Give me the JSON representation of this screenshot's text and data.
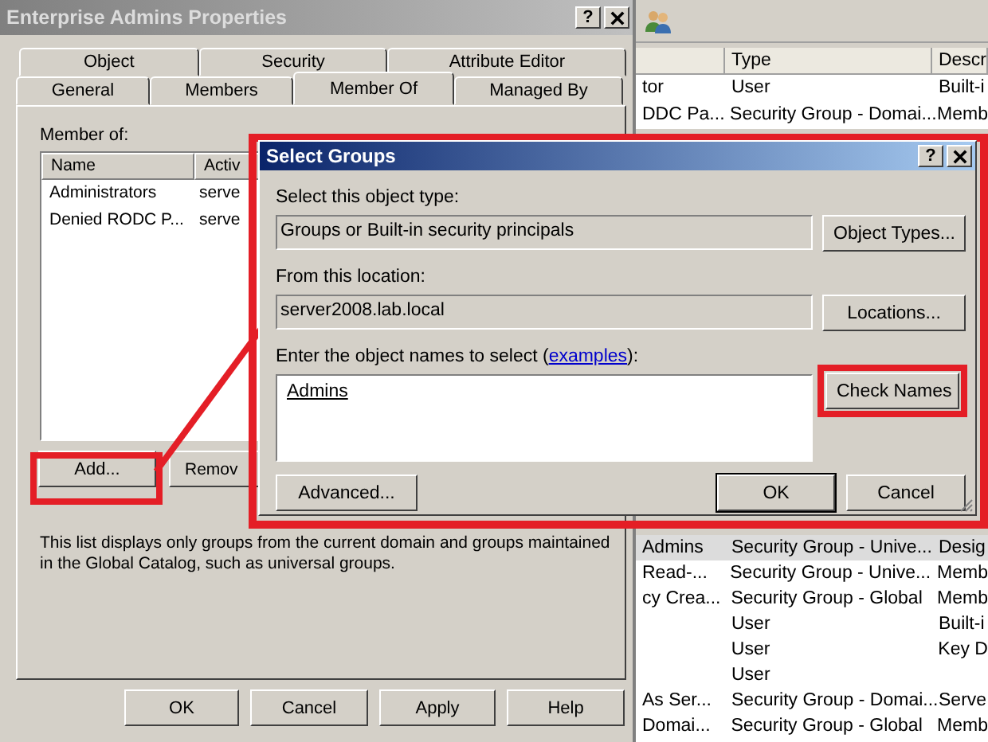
{
  "background_window": {
    "columns": [
      "Type",
      "Descr"
    ],
    "rows_top": [
      {
        "column_1": "tor",
        "type": "User",
        "descr": "Built-i",
        "selected": false
      },
      {
        "column_1": "DDC Pa...",
        "type": "Security Group - Domai...",
        "descr": "Memb",
        "selected": false
      }
    ],
    "rows_bottom": [
      {
        "column_1": "Admins",
        "type": "Security Group - Unive...",
        "descr": "Desig",
        "selected": true
      },
      {
        "column_1": "Read-...",
        "type": "Security Group - Unive...",
        "descr": "Memb",
        "selected": false
      },
      {
        "column_1": "cy Crea...",
        "type": "Security Group - Global",
        "descr": "Memb",
        "selected": false
      },
      {
        "type": "User",
        "descr": "Built-i",
        "selected": false
      },
      {
        "type": "User",
        "descr": "Key D",
        "selected": false
      },
      {
        "type": "User",
        "selected": false
      },
      {
        "column_1": "As Ser...",
        "type": "Security Group - Domai...",
        "descr": "Serve",
        "selected": false
      },
      {
        "column_1": "Domai...",
        "type": "Security Group - Global",
        "descr": "Memb",
        "selected": false
      }
    ]
  },
  "properties_window": {
    "title": "Enterprise Admins Properties",
    "help_button": "?",
    "tab_rows": [
      [
        {
          "label": "Object",
          "selected": false
        },
        {
          "label": "Security",
          "selected": false
        },
        {
          "label": "Attribute Editor",
          "selected": false
        }
      ],
      [
        {
          "label": "General",
          "selected": false
        },
        {
          "label": "Members",
          "selected": false
        },
        {
          "label": "Member Of",
          "selected": true
        },
        {
          "label": "Managed By",
          "selected": false
        }
      ]
    ],
    "member_of_label": "Member of:",
    "list_columns": [
      "Name",
      "Activ"
    ],
    "list_rows": [
      {
        "name": "Administrators",
        "column_2": "serve"
      },
      {
        "name": "Denied RODC P...",
        "column_2": "serve"
      }
    ],
    "add_button": {
      "label": "Add...",
      "highlighted": true
    },
    "remove_button": {
      "label": "Remov"
    },
    "note": "This list displays only groups from the current domain and groups maintained in the Global Catalog, such as universal groups.",
    "footer_buttons": [
      "OK",
      "Cancel",
      "Apply",
      "Help"
    ]
  },
  "select_groups_dialog": {
    "title": "Select Groups",
    "help_button": "?",
    "highlighted": true,
    "object_type_label": "Select this object type:",
    "object_type_value": "Groups or Built-in security principals",
    "object_types_button": "Object Types...",
    "location_label": "From this location:",
    "location_value": "server2008.lab.local",
    "locations_button": "Locations...",
    "names_label_before": "Enter the object names to select (",
    "names_label_link": "examples",
    "names_label_after": "):",
    "names_value": "Admins",
    "check_names_button": {
      "label": "Check Names",
      "highlighted": true
    },
    "advanced_button": "Advanced...",
    "ok_button": "OK",
    "cancel_button": "Cancel"
  }
}
